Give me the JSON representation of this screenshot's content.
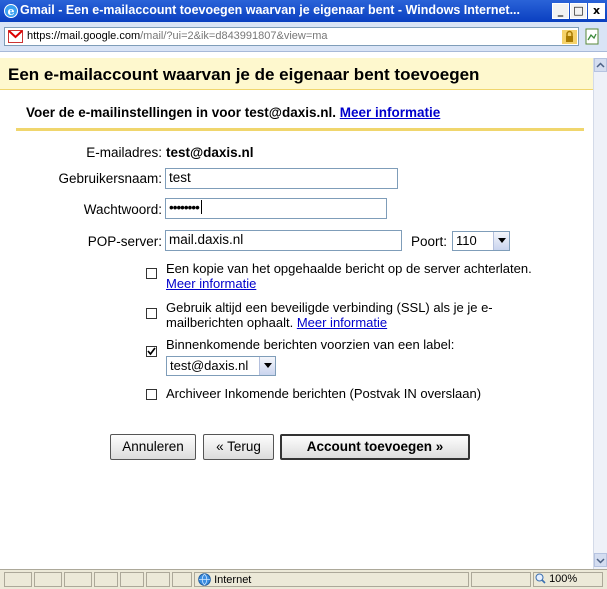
{
  "window": {
    "title": "Gmail - Een e-mailaccount toevoegen waarvan je eigenaar bent - Windows Internet...",
    "url_prefix": "https://mail.",
    "url_domain": "google.com",
    "url_rest": "/mail/?ui=2&ik=d843991807&view=ma"
  },
  "page": {
    "heading": "Een e-mailaccount waarvan je de eigenaar bent toevoegen",
    "subheading": "Voer de e-mailinstellingen in voor test@daxis.nl.",
    "more_info": "Meer informatie"
  },
  "form": {
    "email_label": "E-mailadres:",
    "email_value": "test@daxis.nl",
    "username_label": "Gebruikersnaam:",
    "username_value": "test",
    "password_label": "Wachtwoord:",
    "password_value": "••••••••",
    "pop_label": "POP-server:",
    "pop_value": "mail.daxis.nl",
    "port_label": "Poort:",
    "port_value": "110"
  },
  "options": [
    {
      "line1": "Een kopie van het opgehaalde bericht op de server achterlaten.",
      "link": "Meer informatie",
      "checked": false
    },
    {
      "line1": "Gebruik altijd een beveiligde verbinding (SSL) als je je e-",
      "line2": "mailberichten ophaalt.",
      "link": "Meer informatie",
      "checked": false
    },
    {
      "line1": "Binnenkomende berichten voorzien van een label:",
      "select_value": "test@daxis.nl",
      "checked": true
    },
    {
      "line1": "Archiveer Inkomende berichten (Postvak IN overslaan)",
      "checked": false
    }
  ],
  "buttons": {
    "cancel": "Annuleren",
    "back": "« Terug",
    "add": "Account toevoegen »"
  },
  "status": {
    "zone": "Internet",
    "zoom": "100%"
  },
  "icons": [
    "ie-icon",
    "gmail-icon",
    "lock-icon",
    "page-icon",
    "globe-icon",
    "zoom-icon",
    "check-icon"
  ],
  "colors": {
    "header_bg": "#fef8ce",
    "rule": "#f0d66d",
    "link": "#0000cc",
    "titlebar": "#0a3fc0"
  }
}
